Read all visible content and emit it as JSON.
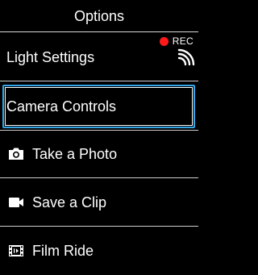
{
  "header": {
    "title": "Options"
  },
  "status": {
    "rec_label": "REC",
    "rec_color": "#ff1a1a",
    "signal_icon": "signal-waves-icon"
  },
  "menu": {
    "items": [
      {
        "label": "Light Settings",
        "icon": ""
      },
      {
        "label": "Camera Controls",
        "icon": "",
        "selected": true
      },
      {
        "label": "Take a Photo",
        "icon": "camera-icon"
      },
      {
        "label": "Save a Clip",
        "icon": "video-camera-icon"
      },
      {
        "label": "Film Ride",
        "icon": "film-icon"
      }
    ]
  },
  "colors": {
    "background": "#000000",
    "text": "#ffffff",
    "focus": "#33a6e8"
  }
}
